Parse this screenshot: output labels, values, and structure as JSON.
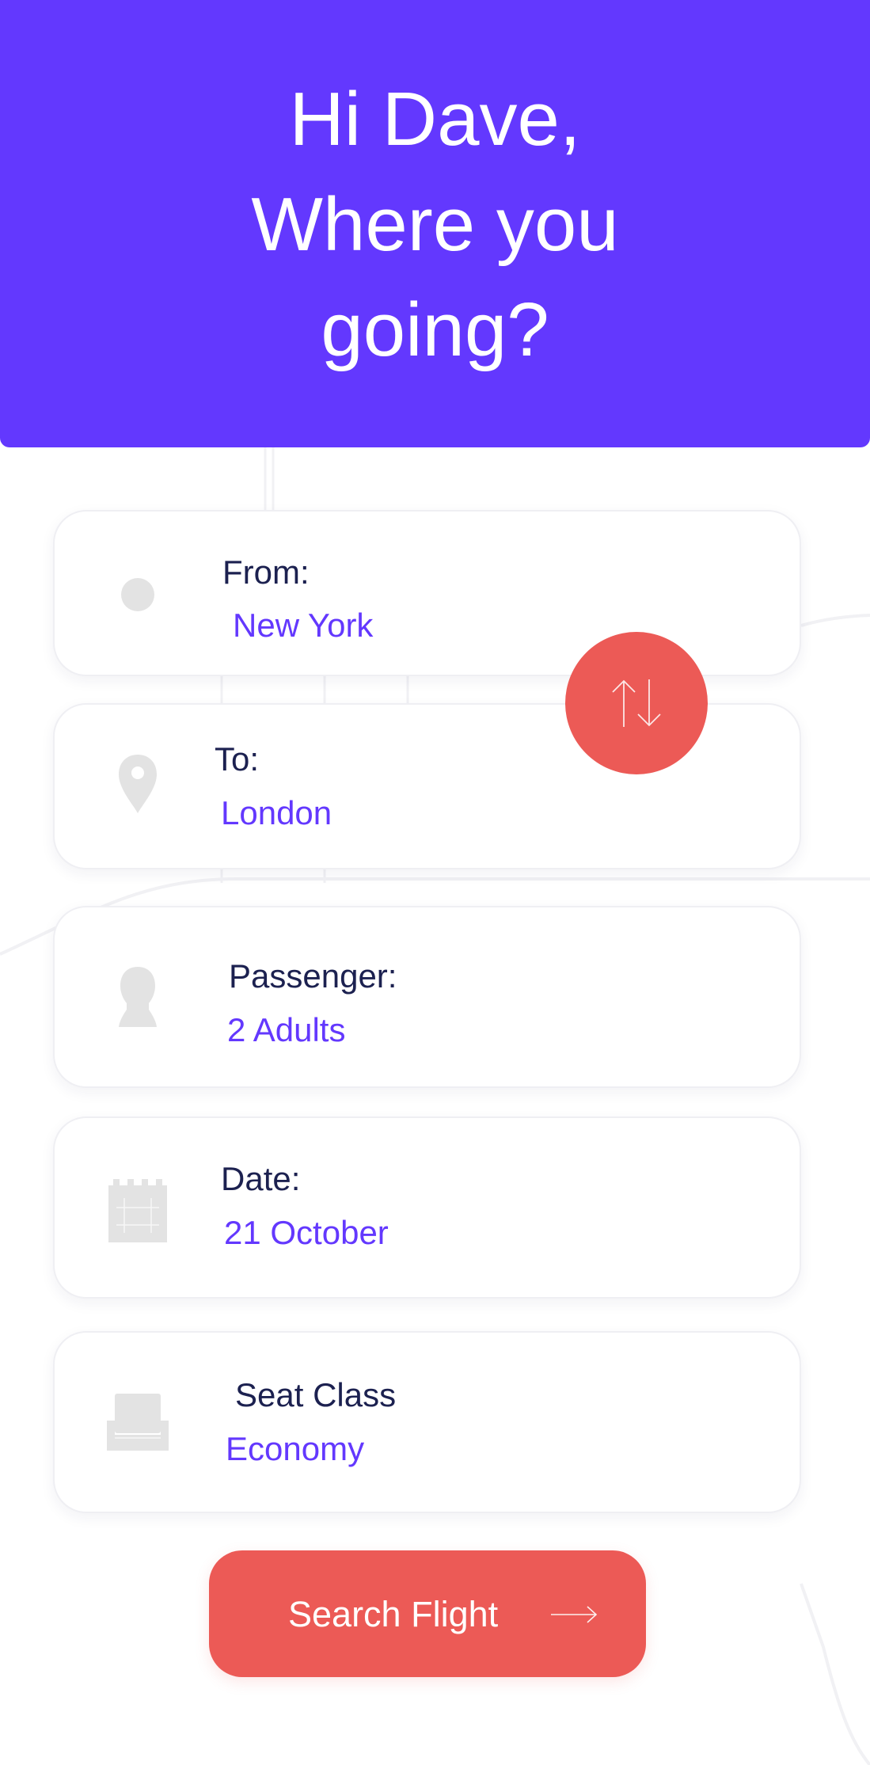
{
  "colors": {
    "accent": "#6338fe",
    "navy": "#1c2150",
    "coral": "#ec5a56",
    "icon_gray": "#e3e3e3"
  },
  "header": {
    "greeting": "Hi Dave,\nWhere you\ngoing?"
  },
  "fields": {
    "from": {
      "label": "From:",
      "value": "New York",
      "icon": "origin-dot-icon"
    },
    "to": {
      "label": "To:",
      "value": "London",
      "icon": "map-pin-icon"
    },
    "passenger": {
      "label": "Passenger:",
      "value": "2 Adults",
      "icon": "person-icon"
    },
    "date": {
      "label": "Date:",
      "value": "21 October",
      "icon": "calendar-icon"
    },
    "seat_class": {
      "label": "Seat Class",
      "value": "Economy",
      "icon": "seat-icon"
    }
  },
  "swap": {
    "icon": "swap-arrows-icon"
  },
  "search": {
    "label": "Search Flight",
    "icon": "arrow-right-icon"
  }
}
